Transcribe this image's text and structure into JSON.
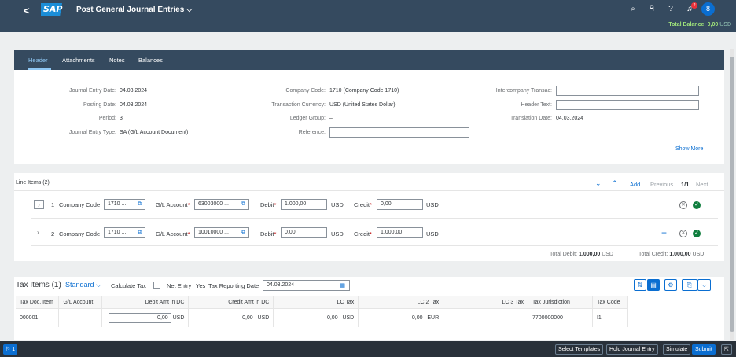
{
  "app": {
    "title": "Post General Journal Entries",
    "title_chevron": "⌵",
    "back_glyph": "<",
    "logo": "SAP"
  },
  "shell_icons": {
    "search": "⌕",
    "assistant": "ᑫ",
    "help": "?",
    "bell": "♫",
    "bell_badge": "2",
    "avatar": "8"
  },
  "balance": {
    "label": "Total Balance: 0,00",
    "currency": "USD",
    "color": "#9fe27a"
  },
  "tabs": [
    {
      "label": "Header"
    },
    {
      "label": "Attachments"
    },
    {
      "label": "Notes"
    },
    {
      "label": "Balances"
    }
  ],
  "header": {
    "journal_entry_date": {
      "label": "Journal Entry Date:",
      "value": "04.03.2024"
    },
    "posting_date": {
      "label": "Posting Date:",
      "value": "04.03.2024"
    },
    "period": {
      "label": "Period:",
      "value": "3"
    },
    "journal_entry_type": {
      "label": "Journal Entry Type:",
      "value": "SA (G/L Account Document)"
    },
    "company_code": {
      "label": "Company Code:",
      "value": "1710 (Company Code 1710)"
    },
    "transaction_currency": {
      "label": "Transaction Currency:",
      "value": "USD (United States Dollar)"
    },
    "ledger_group": {
      "label": "Ledger Group:",
      "value": "–"
    },
    "reference": {
      "label": "Reference:",
      "value": ""
    },
    "intercompany": {
      "label": "Intercompany Transac:",
      "value": ""
    },
    "header_text": {
      "label": "Header Text:",
      "value": ""
    },
    "translation_date": {
      "label": "Translation Date:",
      "value": "04.03.2024"
    },
    "show_more": "Show More"
  },
  "line_items": {
    "title": "Line Items (2)",
    "toolbar": {
      "add": "Add",
      "previous": "Previous",
      "page": "1/1",
      "next": "Next"
    },
    "rows": [
      {
        "no": "1",
        "cc_label": "Company Code",
        "cc": "1710 ...",
        "gl_label": "G/L Account",
        "gl": "63003000 ...",
        "debit_label": "Debit",
        "debit": "1.000,00",
        "debit_cur": "USD",
        "credit_label": "Credit",
        "credit": "0,00",
        "credit_cur": "USD"
      },
      {
        "no": "2",
        "cc_label": "Company Code",
        "cc": "1710 ...",
        "gl_label": "G/L Account",
        "gl": "10010000 ...",
        "debit_label": "Debit",
        "debit": "0,00",
        "debit_cur": "USD",
        "credit_label": "Credit",
        "credit": "1.000,00",
        "credit_cur": "USD"
      }
    ],
    "total_debit_label": "Total Debit:",
    "total_debit": "1.000,00",
    "total_debit_cur": "USD",
    "total_credit_label": "Total Credit:",
    "total_credit": "1.000,00",
    "total_credit_cur": "USD"
  },
  "tax": {
    "title": "Tax Items (1)",
    "variant": "Standard",
    "calc_tax": "Calculate Tax",
    "net_entry": "Net Entry",
    "net_entry_value": "Yes",
    "reporting_date_label": "Tax Reporting Date",
    "reporting_date": "04.03.2024",
    "columns": [
      "Tax Doc. Item",
      "G/L Account",
      "Debit Amt in DC",
      "Credit Amt in DC",
      "LC Tax",
      "LC 2 Tax",
      "LC 3 Tax",
      "Tax Jurisdiction",
      "Tax Code"
    ],
    "row": {
      "item": "000001",
      "gl": "",
      "debit": "0,00",
      "debit_cur": "USD",
      "credit": "0,00",
      "credit_cur": "USD",
      "lc": "0,00",
      "lc_cur": "USD",
      "lc2": "0,00",
      "lc2_cur": "EUR",
      "lc3": "",
      "jurisdiction": "7700000000",
      "code": "I1"
    }
  },
  "footer": {
    "messages": "1",
    "select_templates": "Select Templates",
    "hold": "Hold Journal Entry",
    "simulate": "Simulate",
    "submit": "Submit"
  }
}
